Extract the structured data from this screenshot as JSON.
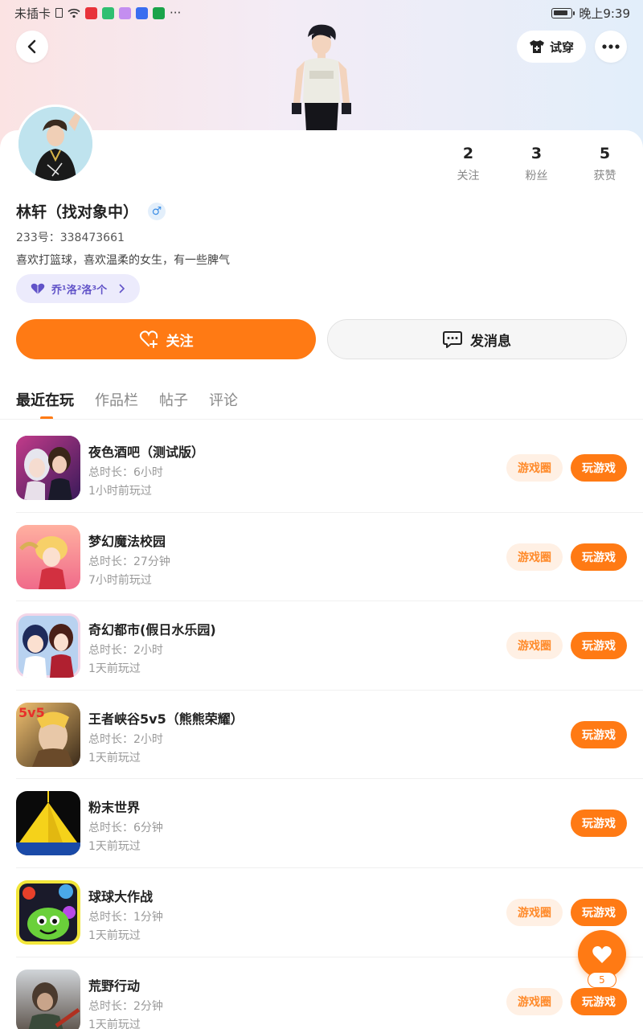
{
  "status_bar": {
    "carrier": "未插卡",
    "more": "···",
    "time": "晚上9:39"
  },
  "header": {
    "try_on_label": "试穿"
  },
  "profile": {
    "stats": [
      {
        "value": "2",
        "label": "关注"
      },
      {
        "value": "3",
        "label": "粉丝"
      },
      {
        "value": "5",
        "label": "获赞"
      }
    ],
    "name": "林轩（找对象中）",
    "gender_symbol": "♂",
    "id_text": "233号：338473661",
    "bio": "喜欢打篮球，喜欢温柔的女生，有一些脾气",
    "cp_tag": "乔¹洛²洛³个",
    "follow_label": "关注",
    "message_label": "发消息"
  },
  "tabs": [
    "最近在玩",
    "作品栏",
    "帖子",
    "评论"
  ],
  "games": [
    {
      "name": "夜色酒吧（测试版）",
      "duration": "总时长：6小时",
      "last_played": "1小时前玩过",
      "circle": true
    },
    {
      "name": "梦幻魔法校园",
      "duration": "总时长：27分钟",
      "last_played": "7小时前玩过",
      "circle": true
    },
    {
      "name": "奇幻都市(假日水乐园)",
      "duration": "总时长：2小时",
      "last_played": "1天前玩过",
      "circle": true
    },
    {
      "name": "王者峡谷5v5（熊熊荣耀）",
      "duration": "总时长：2小时",
      "last_played": "1天前玩过",
      "circle": false
    },
    {
      "name": "粉末世界",
      "duration": "总时长：6分钟",
      "last_played": "1天前玩过",
      "circle": false
    },
    {
      "name": "球球大作战",
      "duration": "总时长：1分钟",
      "last_played": "1天前玩过",
      "circle": true
    },
    {
      "name": "荒野行动",
      "duration": "总时长：2分钟",
      "last_played": "1天前玩过",
      "circle": true
    }
  ],
  "game_buttons": {
    "circle_label": "游戏圈",
    "play_label": "玩游戏"
  },
  "float_like": {
    "count": "5"
  },
  "colors": {
    "accent": "#ff7a14",
    "accent_light": "#fff0e4",
    "tag_bg": "#ecebfc",
    "tag_text": "#6153c8"
  }
}
